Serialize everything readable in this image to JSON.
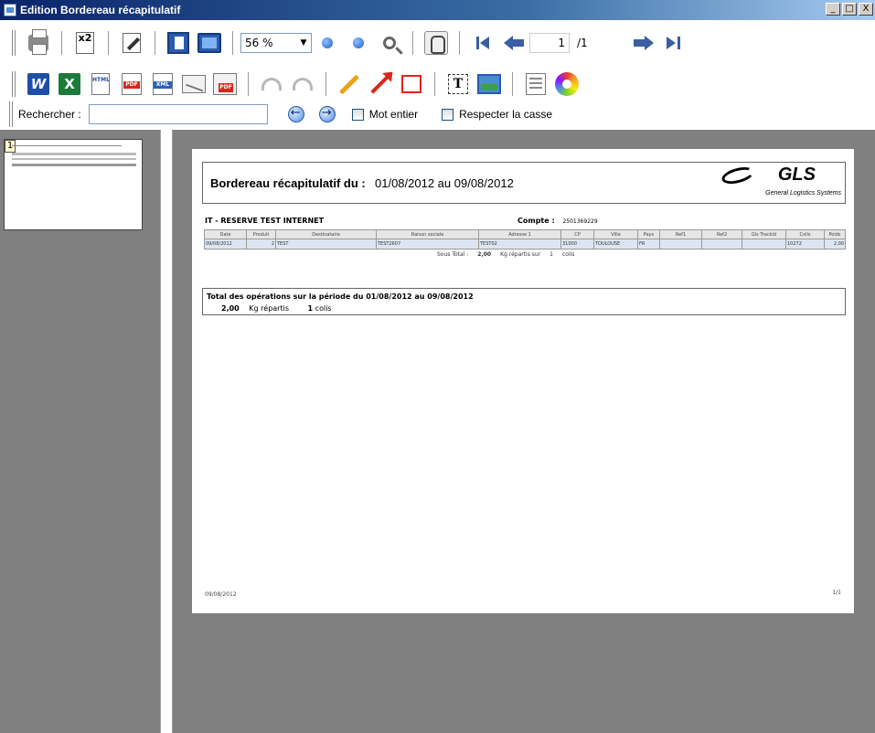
{
  "window": {
    "title": "Edition Bordereau récapitulatif",
    "controls": [
      "_",
      "□",
      "X"
    ]
  },
  "toolbar1": {
    "zoom_value": "56 %",
    "page_current": "1",
    "page_total": "/1"
  },
  "toolbar3": {
    "search_label": "Rechercher :",
    "search_value": "",
    "whole_word_label": "Mot entier",
    "match_case_label": "Respecter la casse"
  },
  "thumbnails": [
    {
      "number": "1"
    }
  ],
  "report": {
    "title": "Bordereau récapitulatif du :",
    "dates": "01/08/2012 au 09/08/2012",
    "logo": {
      "name": "GLS",
      "subtitle": "General Logistics Systems"
    },
    "section": "IT - RESERVE TEST INTERNET",
    "compte_label": "Compte :",
    "compte_value": "2501369229",
    "columns": [
      "Date",
      "Produit",
      "Destinataire",
      "Raison sociale",
      "Adresse 1",
      "CP",
      "Ville",
      "Pays",
      "Ref1",
      "Ref2",
      "Gls TrackId",
      "Colis",
      "Poids"
    ],
    "rows": [
      [
        "09/08/2012",
        "2",
        "TEST",
        "TEST2607",
        "TEST02",
        "31000",
        "TOULOUSE",
        "FR",
        "",
        "",
        "",
        "10272",
        "2,00"
      ]
    ],
    "sous_total": {
      "label": "Sous Total :",
      "weight": "2,00",
      "text1": "Kg répartis sur",
      "colis_count": "1",
      "text2": "colis"
    },
    "total": {
      "line1": "Total des opérations sur la période du  01/08/2012  au  09/08/2012",
      "weight": "2,00",
      "weight_text": "Kg répartis",
      "colis_count": "1",
      "colis_text": "colis"
    },
    "footer_date": "09/08/2012",
    "footer_page": "1/1"
  }
}
